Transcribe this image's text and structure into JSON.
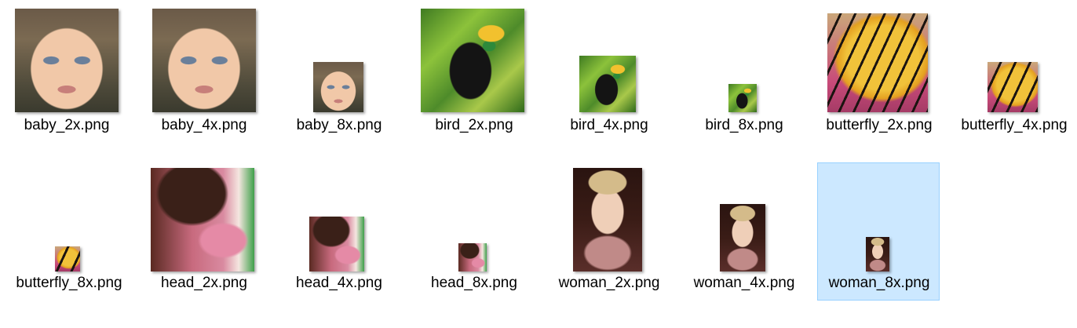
{
  "files": [
    {
      "name": "baby_2x.png",
      "picture": "baby",
      "selected": false
    },
    {
      "name": "baby_4x.png",
      "picture": "baby",
      "selected": false
    },
    {
      "name": "baby_8x.png",
      "picture": "baby",
      "selected": false
    },
    {
      "name": "bird_2x.png",
      "picture": "bird",
      "selected": false
    },
    {
      "name": "bird_4x.png",
      "picture": "bird",
      "selected": false
    },
    {
      "name": "bird_8x.png",
      "picture": "bird",
      "selected": false
    },
    {
      "name": "butterfly_2x.png",
      "picture": "butterfly",
      "selected": false
    },
    {
      "name": "butterfly_4x.png",
      "picture": "butterfly",
      "selected": false
    },
    {
      "name": "butterfly_8x.png",
      "picture": "butterfly",
      "selected": false
    },
    {
      "name": "head_2x.png",
      "picture": "head",
      "selected": false
    },
    {
      "name": "head_4x.png",
      "picture": "head",
      "selected": false
    },
    {
      "name": "head_8x.png",
      "picture": "head",
      "selected": false
    },
    {
      "name": "woman_2x.png",
      "picture": "woman",
      "selected": false
    },
    {
      "name": "woman_4x.png",
      "picture": "woman",
      "selected": false
    },
    {
      "name": "woman_8x.png",
      "picture": "woman",
      "selected": true
    }
  ],
  "colors": {
    "selection_bg": "#cce8ff",
    "selection_border": "#99d1ff"
  }
}
